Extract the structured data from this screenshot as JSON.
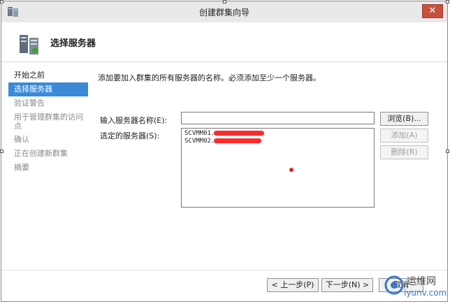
{
  "window": {
    "title": "创建群集向导",
    "close_label": "✕"
  },
  "header": {
    "title": "选择服务器"
  },
  "sidebar": {
    "items": [
      {
        "label": "开始之前"
      },
      {
        "label": "选择服务器"
      },
      {
        "label": "验证警告"
      },
      {
        "label": "用于管理群集的访问点"
      },
      {
        "label": "确认"
      },
      {
        "label": "正在创建新群集"
      },
      {
        "label": "摘要"
      }
    ]
  },
  "content": {
    "instruction": "添加要加入群集的所有服务器的名称。必须添加至少一个服务器。",
    "server_input_label": "输入服务器名称(E):",
    "server_input_value": "",
    "selected_label": "选定的服务器(S):",
    "selected_servers": [
      "SCVMM01.",
      "SCVMM02."
    ],
    "browse_button": "浏览(B)...",
    "add_button": "添加(A)",
    "remove_button": "删除(R)"
  },
  "footer": {
    "back_button": "< 上一步(P)",
    "next_button": "下一步(N) >",
    "cancel_button": "取消"
  },
  "watermark": {
    "line1": "运维网",
    "line2": "iyunv.com"
  },
  "colors": {
    "selected_step": "#3a8ad8",
    "close_button": "#c7503f",
    "redaction": "#ff1f1f"
  }
}
